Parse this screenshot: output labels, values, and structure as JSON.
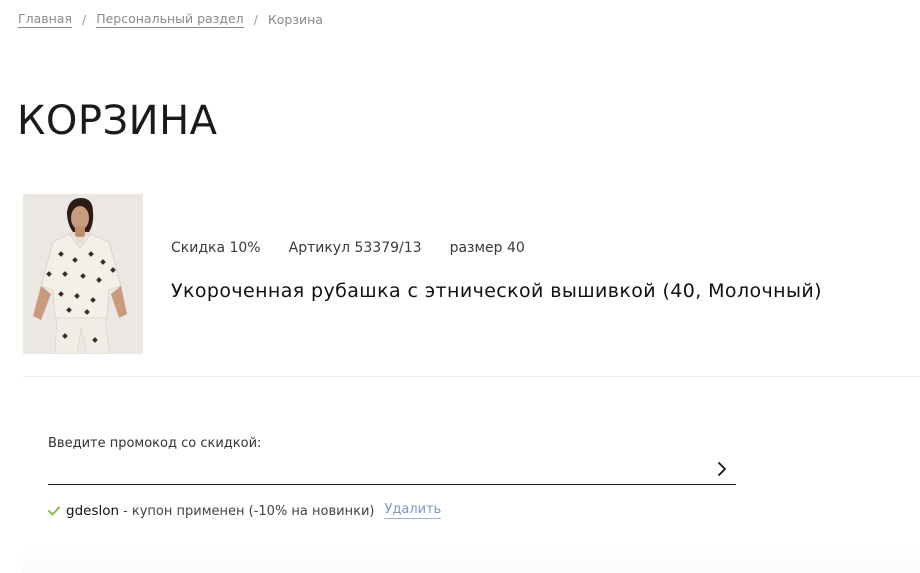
{
  "breadcrumb": {
    "home": "Главная",
    "personal": "Персональный раздел",
    "separator": "/",
    "current": "Корзина"
  },
  "page": {
    "title": "КОРЗИНА"
  },
  "cart_item": {
    "discount": "Скидка 10%",
    "article": "Артикул 53379/13",
    "size": "размер 40",
    "name": "Укороченная рубашка с этнической вышивкой (40, Молочный)",
    "image_icon": "product-photo"
  },
  "promo": {
    "label": "Введите промокод со скидкой:",
    "value": "",
    "placeholder": "",
    "submit_icon": "chevron-right-icon"
  },
  "coupon": {
    "status_icon": "check-icon",
    "code": "gdeslon",
    "message": "- купон применен (-10% на новинки)",
    "remove_label": "Удалить",
    "check_color": "#7cc242",
    "remove_color": "#7a9ac4"
  }
}
